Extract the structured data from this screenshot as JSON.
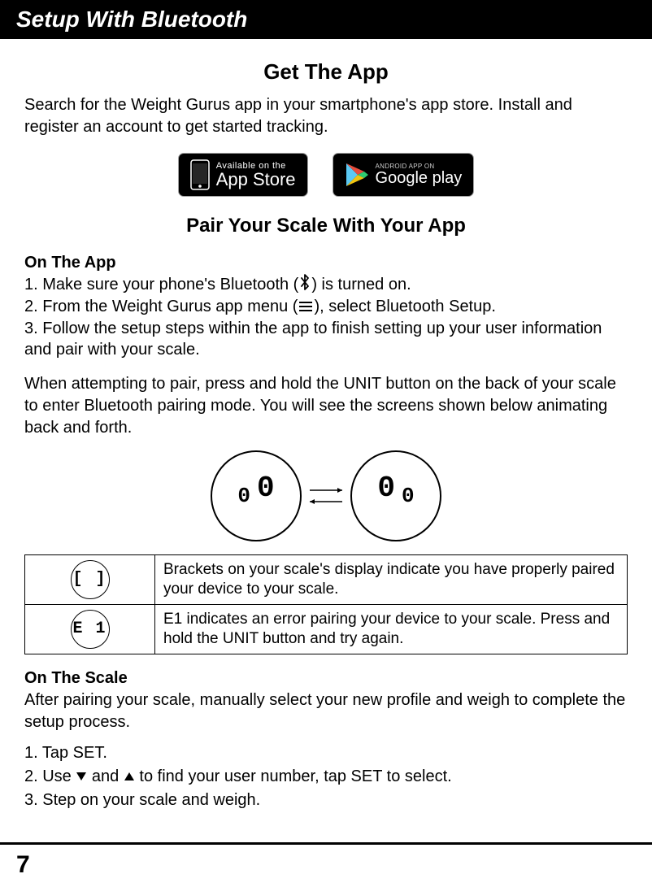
{
  "header": "Setup With Bluetooth",
  "getApp": {
    "title": "Get The App",
    "text": "Search for the Weight Gurus app in your smartphone's app store. Install and register an account to get started tracking.",
    "appstore_small": "Available on the",
    "appstore_big": "App Store",
    "google_small": "ANDROID APP ON",
    "google_big": "Google play"
  },
  "pair": {
    "title": "Pair Your Scale With Your App",
    "onApp": "On The App",
    "step1a": "1. Make sure your phone's Bluetooth (",
    "step1b": ") is turned on.",
    "step2a": "2. From the Weight Gurus app menu (",
    "step2b": "), select Bluetooth Setup.",
    "step3": "3. Follow the setup steps within the app to finish setting up your user information and pair with your scale.",
    "note": "When attempting to pair, press and hold the UNIT button on the back of your scale to enter Bluetooth pairing mode.  You will see the screens shown below animating back and forth."
  },
  "status": {
    "brackets_code": "[ ]",
    "brackets_text": "Brackets on your scale's display indicate you have properly paired your device to your scale.",
    "e1_code": "E 1",
    "e1_text": "E1 indicates an error pairing your device to your scale.  Press and hold the UNIT button and try again."
  },
  "onScale": {
    "heading": "On The Scale",
    "text": "After pairing your scale, manually select your new profile and weigh to complete the setup process.",
    "s1": "1.  Tap SET.",
    "s2a": "2.  Use ",
    "s2b": " and ",
    "s2c": " to find your user number, tap SET to select.",
    "s3": "3.  Step on your scale and weigh."
  },
  "pageNumber": "7"
}
